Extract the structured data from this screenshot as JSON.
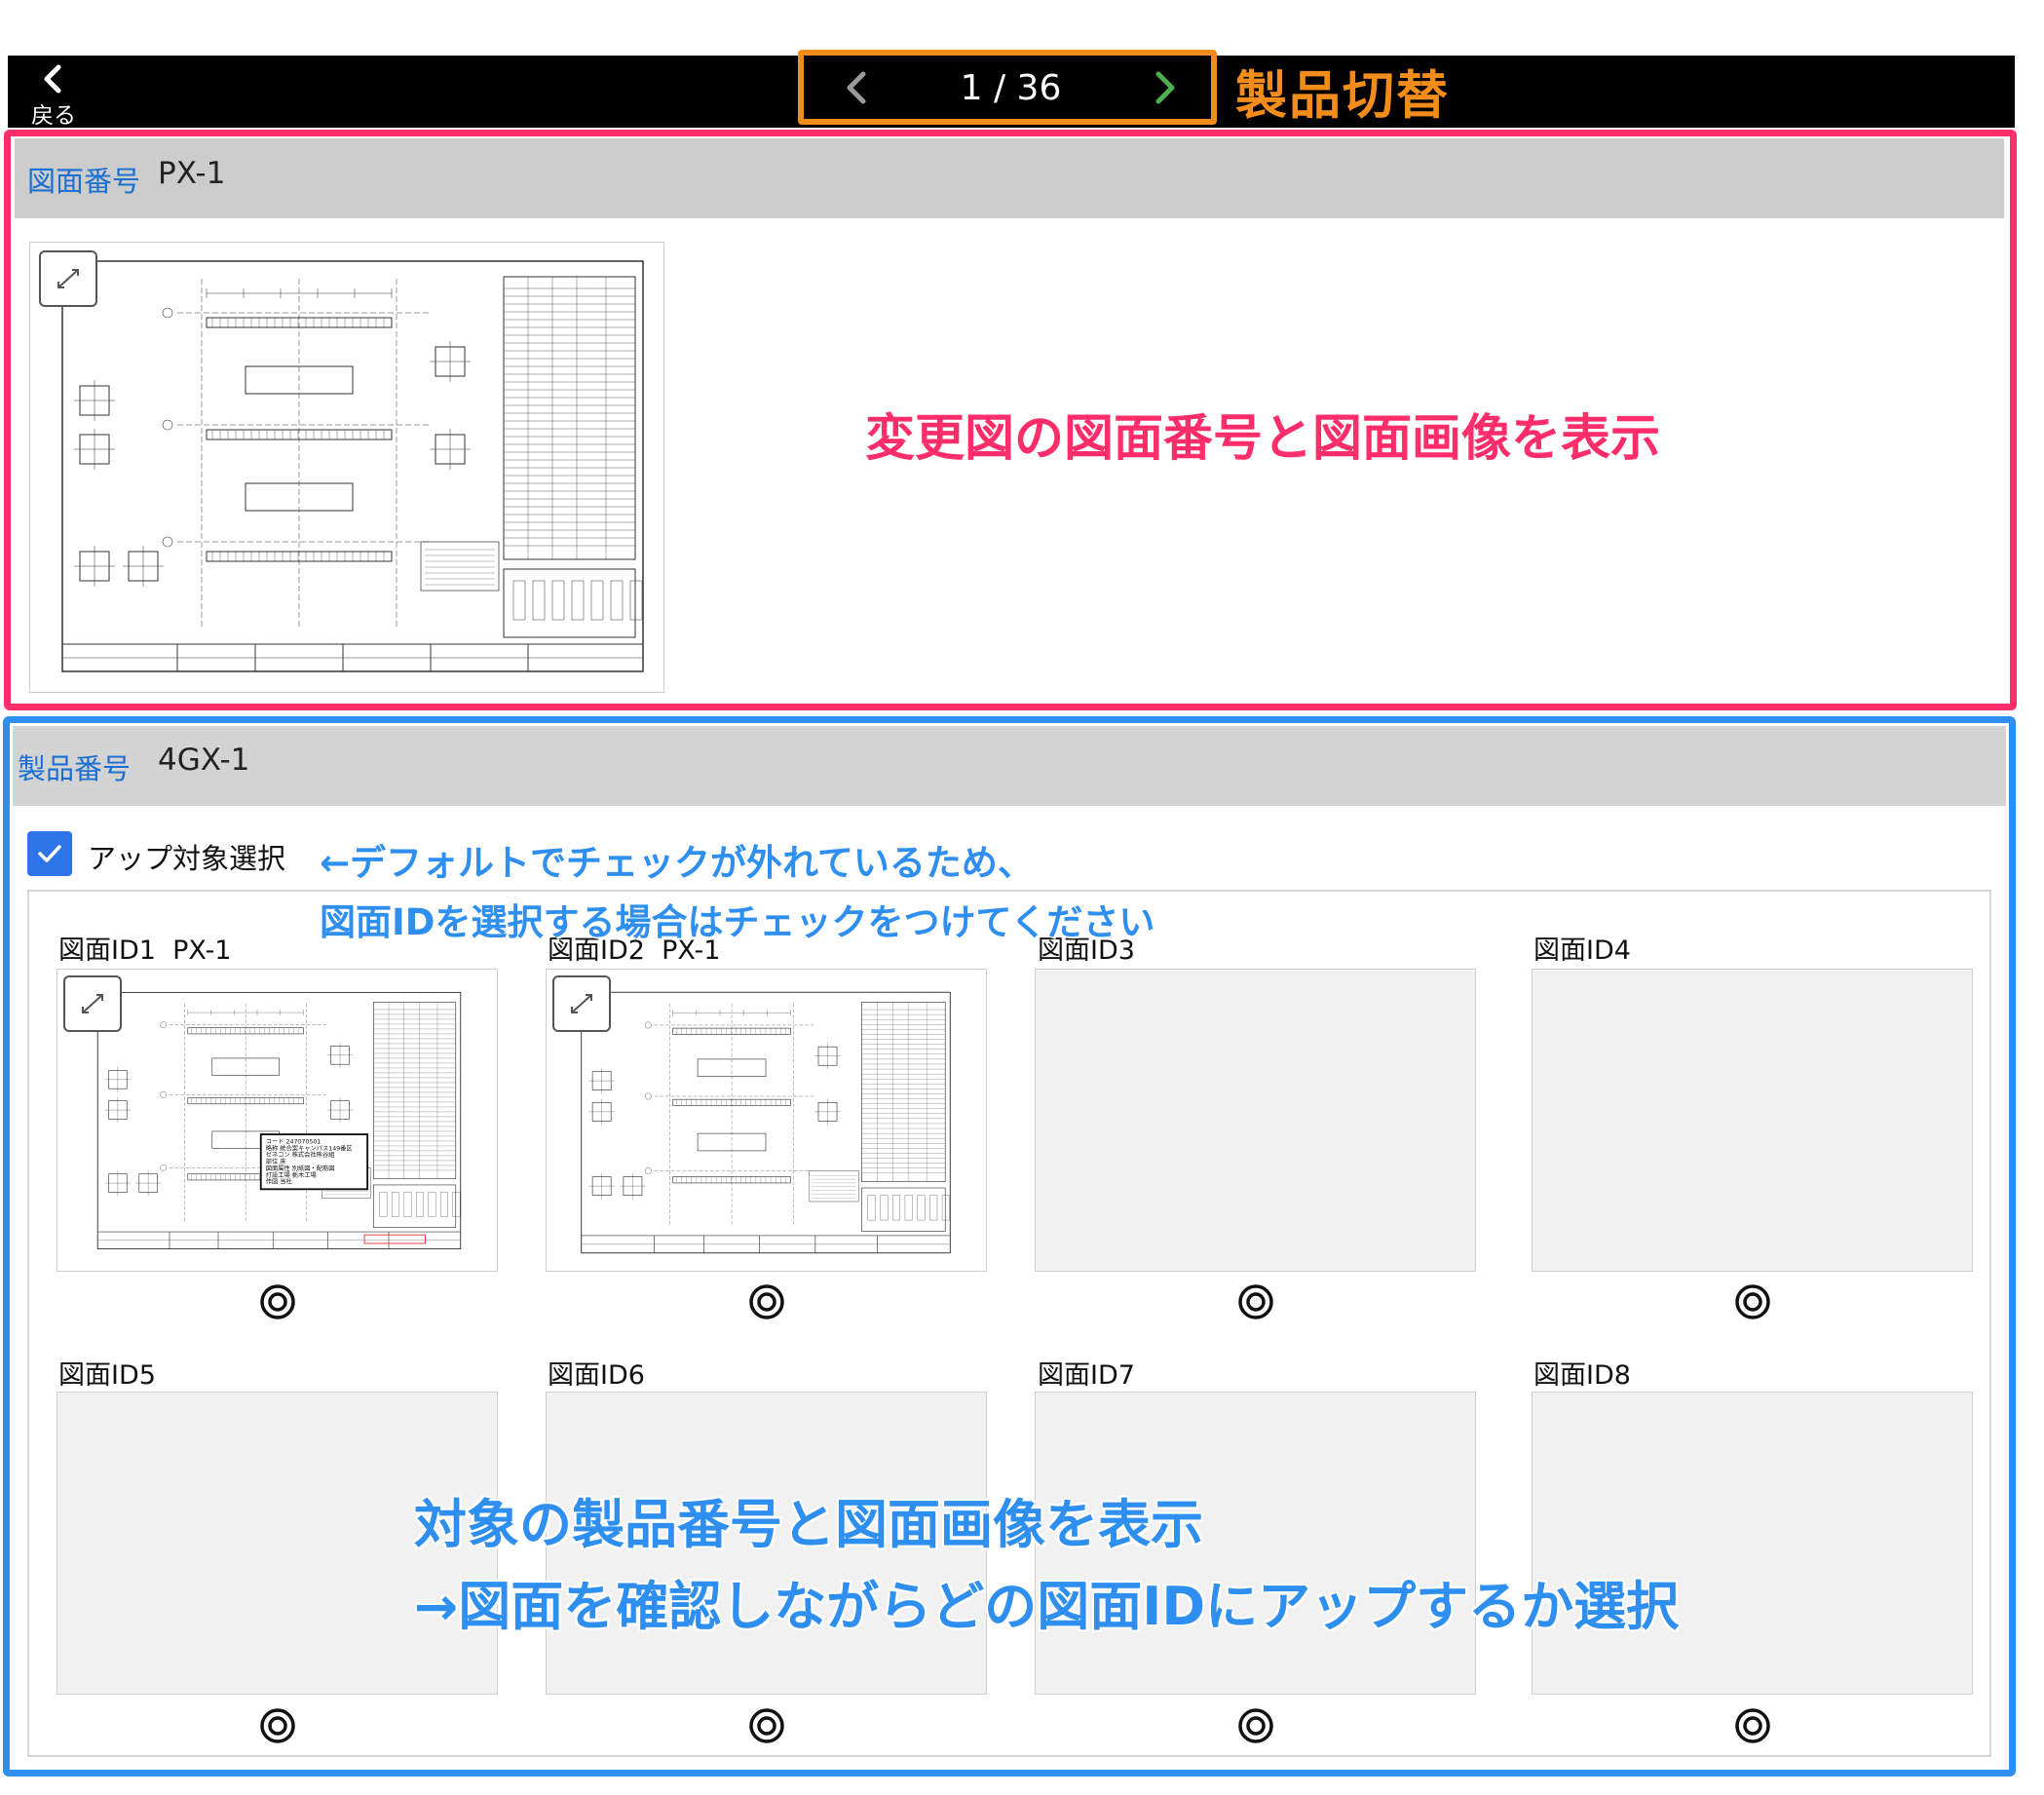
{
  "top_bar": {
    "back_label": "戻る",
    "page_counter": "1 / 36",
    "annotation": "製品切替"
  },
  "drawing_section": {
    "key": "図面番号",
    "value": "PX-1",
    "annotation": "変更図の図面番号と図面画像を表示"
  },
  "product_section": {
    "key": "製品番号",
    "value": "4GX-1",
    "checkbox_label": "アップ対象選択",
    "checkbox_note_1": "←デフォルトでチェックが外れているため、",
    "checkbox_note_2": "図面IDを選択する場合はチェックをつけてください",
    "annotation_1": "対象の製品番号と図面画像を表示",
    "annotation_2": "→図面を確認しながらどの図面IDにアップするか選択",
    "slots": [
      {
        "label": "図面ID1",
        "drawing": "PX-1"
      },
      {
        "label": "図面ID2",
        "drawing": "PX-1"
      },
      {
        "label": "図面ID3",
        "drawing": ""
      },
      {
        "label": "図面ID4",
        "drawing": ""
      },
      {
        "label": "図面ID5",
        "drawing": ""
      },
      {
        "label": "図面ID6",
        "drawing": ""
      },
      {
        "label": "図面ID7",
        "drawing": ""
      },
      {
        "label": "図面ID8",
        "drawing": ""
      }
    ],
    "stamp_lines": [
      "コード 247070501",
      "略称 統合案キャンパス149番区",
      "ゼネコン 株式会社熊谷組",
      "部位 床",
      "図面属性 別紙図・配筋図",
      "打設工場 栃木工場",
      "作図 当社"
    ]
  },
  "colors": {
    "orange": "#f28c1a",
    "pink": "#ff2d6a",
    "blue": "#2e8ff0",
    "link_blue": "#1a6fd1",
    "checkbox_blue": "#2d74e8",
    "next_green": "#4caf50"
  },
  "icons": {
    "back": "chevron-left-icon",
    "prev": "chevron-left-icon",
    "next": "chevron-right-icon",
    "expand": "expand-icon",
    "check": "check-icon",
    "radio": "radio-icon"
  }
}
